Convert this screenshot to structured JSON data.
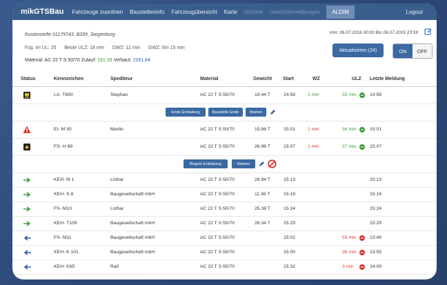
{
  "nav": {
    "brand": "mikGTSBau",
    "items": [
      "Fahrzeuge zuordnen",
      "Baustelleninfo",
      "Fahrzeugübersicht",
      "Karte",
      "Historie",
      "Gewichtsmeldungen",
      "ALDIM"
    ],
    "logout": "Logout"
  },
  "info": {
    "kostenstelle": "Kostenstelle 01179743, B299_Siegenburg",
    "fzg_label": "Fzg. im UL: 25",
    "ulz_label": "Beste ULZ: 18 min",
    "dwz_label": "DWZ: 11 min",
    "gwz_label": "GWZ: 8m 15 min",
    "material_label": "Material: AC 22 T S 50/70",
    "zulauf_label": "Zulauf:",
    "zulauf_value": "161.28",
    "verbaut_label": "Verbaut:",
    "verbaut_value": "2261.64",
    "range": "Von: 06.07.2016 00:00 Bis 06.07.2016 23:59"
  },
  "controls": {
    "refresh": "Aktualisieren (24)",
    "on": "ON",
    "off": "OFF"
  },
  "table": {
    "headers": [
      "Status",
      "Kennzeichen",
      "Spediteur",
      "Material",
      "Gewicht",
      "Start",
      "WZ",
      "ULZ",
      "Letzte Meldung"
    ]
  },
  "rows": [
    {
      "kz": "LA- T600",
      "sped": "Stephan",
      "mat": "AC 22 T S 50/70",
      "gew": "18.44 T",
      "start": "14:58",
      "wz": "1 min",
      "ulz": "33 min",
      "letzte": "14:58"
    },
    {
      "kz": "EI- M 30",
      "sped": "Martin",
      "mat": "AC 22 T S 50/70",
      "gew": "15.86 T",
      "start": "15:01",
      "wz": "1 min",
      "ulz": "34 min",
      "letzte": "15:01"
    },
    {
      "kz": "FS- H 89",
      "sped": "",
      "mat": "AC 22 T S 50/70",
      "gew": "26.96 T",
      "start": "15:07",
      "wz": "1 min",
      "ulz": "27 min",
      "letzte": "15:07"
    },
    {
      "kz": "KEH- M 1",
      "sped": "Lothar",
      "mat": "AC 22 T S 50/70",
      "gew": "28.94 T",
      "start": "15:13",
      "wz": "",
      "ulz": "",
      "letzte": "15:13"
    },
    {
      "kz": "KEH- S 8",
      "sped": "Baugesellschaft mbH",
      "mat": "AC 22 T S 50/70",
      "gew": "11.36 T",
      "start": "15:19",
      "wz": "",
      "ulz": "",
      "letzte": "15:19"
    },
    {
      "kz": "FS- M10",
      "sped": "Lothar",
      "mat": "AC 22 T S 50/70",
      "gew": "25.38 T",
      "start": "15:24",
      "wz": "",
      "ulz": "",
      "letzte": "15:24"
    },
    {
      "kz": "KEH- T109",
      "sped": "Baugesellschaft mbH",
      "mat": "AC 22 T S 50/70",
      "gew": "26.34 T",
      "start": "15:29",
      "wz": "",
      "ulz": "",
      "letzte": "15:29"
    },
    {
      "kz": "FS- M11",
      "sped": "Baugesellschaft mbH",
      "mat": "AC 22 T S 50/70",
      "gew": "",
      "start": "15:02",
      "wz": "",
      "ulz": "53 min",
      "letzte": "13:49"
    },
    {
      "kz": "KEH- K 101",
      "sped": "Baugesellschaft mbH",
      "mat": "AC 22 T S 50/70",
      "gew": "",
      "start": "15:00",
      "wz": "",
      "ulz": "35 min",
      "letzte": "13:55"
    },
    {
      "kz": "KEH- K85",
      "sped": "Ralf",
      "mat": "AC 22 T S 50/70",
      "gew": "",
      "start": "15:32",
      "wz": "",
      "ulz": "3 min",
      "letzte": "14:09"
    }
  ],
  "actions1": [
    "Ende Entladung",
    "Baustelle Ende",
    "Warten"
  ],
  "actions2": [
    "Beginn Entladung",
    "Warten"
  ],
  "colors": {
    "nav": "#3a5e8c",
    "button": "#3b6aa3",
    "red": "#d33333",
    "green": "#3a9b3a"
  }
}
